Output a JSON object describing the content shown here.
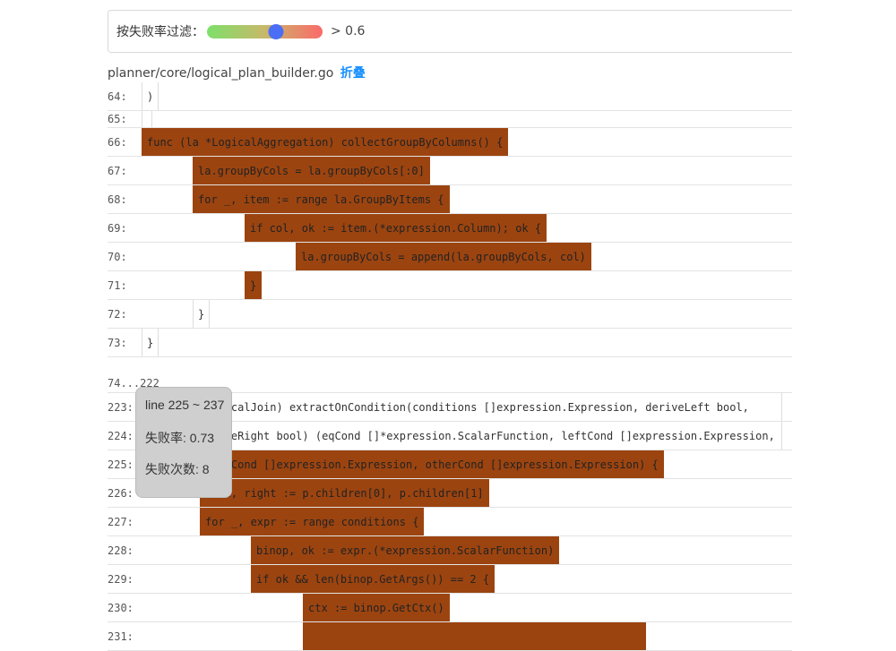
{
  "filter": {
    "label": "按失败率过滤：",
    "threshold_text": "> 0.6",
    "slider_value": 0.6
  },
  "file": {
    "path": "planner/core/logical_plan_builder.go",
    "fold_label": "折叠"
  },
  "lines_block1": [
    {
      "num": "64:",
      "code": ")",
      "hot": false
    },
    {
      "num": "65:",
      "code": "",
      "hot": false
    },
    {
      "num": "66:",
      "code": "func (la *LogicalAggregation) collectGroupByColumns() {",
      "hot": true
    },
    {
      "num": "67:",
      "code": "la.groupByCols = la.groupByCols[:0]",
      "hot": true
    },
    {
      "num": "68:",
      "code": "for _, item := range la.GroupByItems {",
      "hot": true
    },
    {
      "num": "69:",
      "code": "if col, ok := item.(*expression.Column); ok {",
      "hot": true
    },
    {
      "num": "70:",
      "code": "la.groupByCols = append(la.groupByCols, col)",
      "hot": true
    },
    {
      "num": "71:",
      "code": "}",
      "hot": true
    },
    {
      "num": "72:",
      "code": "}",
      "hot": false
    },
    {
      "num": "73:",
      "code": "}",
      "hot": false
    }
  ],
  "collapsed_range": "74...222",
  "lines_block2": [
    {
      "num": "223:",
      "code": "func (p *LogicalJoin) extractOnCondition(conditions []expression.Expression, deriveLeft bool,",
      "hot": false
    },
    {
      "num": "224:",
      "code": "\tderiveRight bool) (eqCond []*expression.ScalarFunction, leftCond []expression.Expression,",
      "hot": false
    },
    {
      "num": "225:",
      "code": "\trightCond []expression.Expression, otherCond []expression.Expression) {",
      "hot": true
    },
    {
      "num": "226:",
      "code": "left, right := p.children[0], p.children[1]",
      "hot": true
    },
    {
      "num": "227:",
      "code": "for _, expr := range conditions {",
      "hot": true
    },
    {
      "num": "228:",
      "code": "binop, ok := expr.(*expression.ScalarFunction)",
      "hot": true
    },
    {
      "num": "229:",
      "code": "if ok && len(binop.GetArgs()) == 2 {",
      "hot": true
    },
    {
      "num": "230:",
      "code": "ctx := binop.GetCtx()",
      "hot": true
    },
    {
      "num": "231:",
      "code": "",
      "hot": true
    }
  ],
  "tooltip": {
    "range": "line 225 ~ 237",
    "fail_rate": "失败率: 0.73",
    "fail_count": "失败次数: 8"
  },
  "colors": {
    "hot": "#9c4410",
    "slider_start": "#7ee06a",
    "slider_end": "#fa6a6a",
    "thumb": "#4a6ef5",
    "link": "#1890ff"
  }
}
